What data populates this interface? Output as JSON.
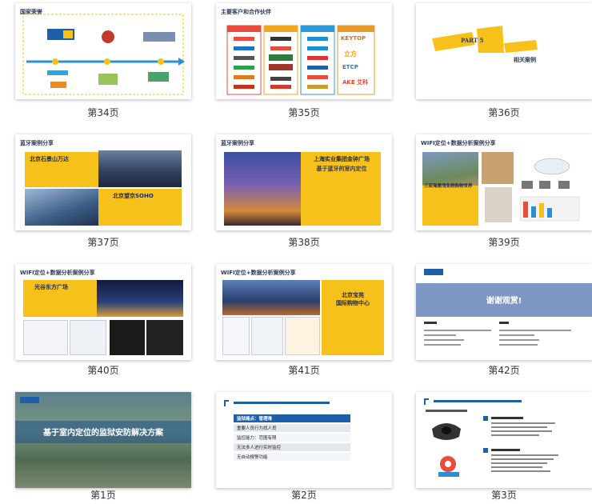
{
  "pages": [
    {
      "label": "第34页",
      "title": "国家荣誉"
    },
    {
      "label": "第35页",
      "title": "主要客户和合作伙伴",
      "logos": [
        "KEYTOP",
        "立方",
        "ETCP",
        "AKE 艾科"
      ]
    },
    {
      "label": "第36页",
      "part": "PART 5",
      "subtitle": "相关案例"
    },
    {
      "label": "第37页",
      "title": "蓝牙案例分享",
      "case1": "北京石景山万达",
      "case2": "北京望京SOHO"
    },
    {
      "label": "第38页",
      "title": "蓝牙案例分享",
      "case1": "上海实业集团金钟广场",
      "case2": "基于蓝牙的室内定位"
    },
    {
      "label": "第39页",
      "title": "WIFI定位+数据分析案例分享",
      "case1": "三亚海棠湾免税购物世界"
    },
    {
      "label": "第40页",
      "title": "WIFI定位+数据分析案例分享",
      "case1": "光谷东方广场"
    },
    {
      "label": "第41页",
      "title": "WIFI定位+数据分析案例分享",
      "case1": "北京宝苑",
      "case2": "国际购物中心"
    },
    {
      "label": "第42页",
      "thanks": "谢谢观赏!"
    },
    {
      "label": "第1页",
      "title": "基于室内定位的监狱安防解决方案"
    },
    {
      "label": "第2页",
      "rows": [
        "监狱痛点：管理难",
        "重要人员行为找人员",
        "监控能力：范围有限",
        "无法多人进行实时监控",
        "无自动报警功能"
      ]
    },
    {
      "label": "第3页"
    }
  ],
  "colors": {
    "accent": "#f7c11b",
    "navy": "#2e3a5c",
    "blue": "#1f5fa8"
  }
}
